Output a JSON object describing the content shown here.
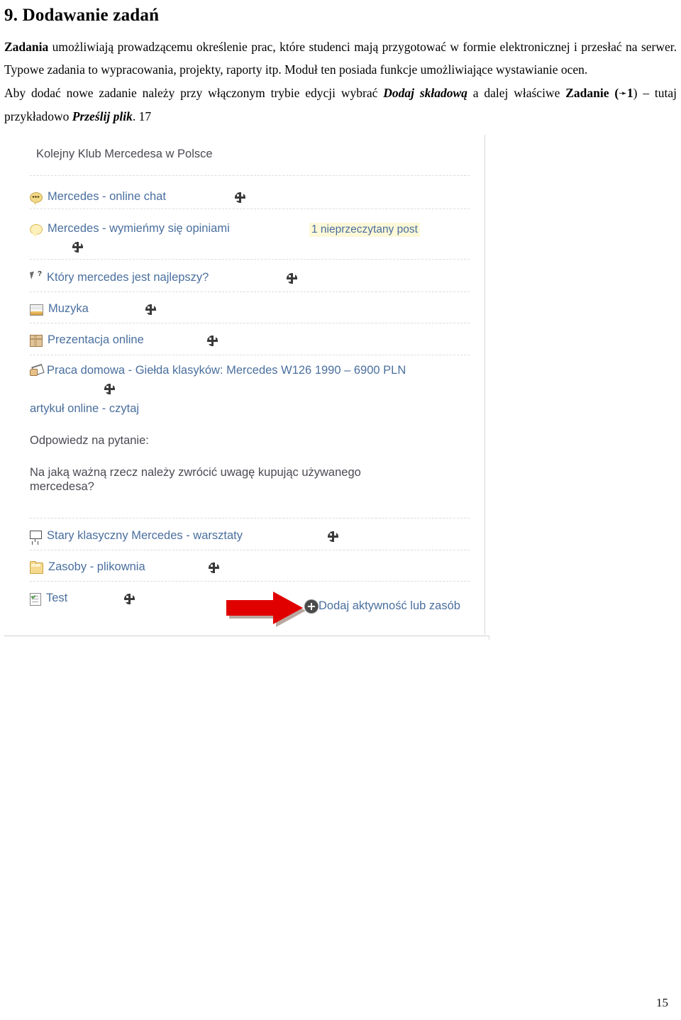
{
  "document": {
    "heading": "9. Dodawanie zadań",
    "paragraphs": [
      {
        "runs": [
          {
            "text": "Zadania",
            "style": "bold"
          },
          {
            "text": " umożliwiają prowadzącemu określenie prac, które studenci mają przygotować w formie elektronicznej i przesłać na serwer. Typowe zadania to wypracowania, projekty, raporty itp. Moduł ten posiada funkcje umożliwiające wystawianie ocen.",
            "style": "normal"
          }
        ]
      },
      {
        "runs": [
          {
            "text": "Aby dodać nowe zadanie należy przy włączonym trybie edycji wybrać ",
            "style": "normal"
          },
          {
            "text": "Dodaj składową",
            "style": "bold-italic"
          },
          {
            "text": " a dalej właściwe ",
            "style": "normal"
          },
          {
            "text": "Zadanie",
            "style": "bold"
          },
          {
            "text": " (",
            "style": "normal"
          },
          {
            "text": "➛",
            "style": "arrow"
          },
          {
            "text": "1",
            "style": "bold"
          },
          {
            "text": ") – tutaj przykładowo ",
            "style": "normal"
          },
          {
            "text": "Prześlij plik",
            "style": "bold-italic"
          },
          {
            "text": ". 17",
            "style": "normal"
          }
        ]
      }
    ],
    "page_number": "15"
  },
  "screenshot": {
    "section_title": "Kolejny Klub Mercedesa w Polsce",
    "activities": [
      {
        "icon": "chat-icon",
        "label": "Mercedes - online chat",
        "badge": null,
        "type": "link"
      },
      {
        "icon": "forum-icon",
        "label": "Mercedes - wymieńmy się opiniami",
        "badge": "1 nieprzeczytany post",
        "type": "link"
      },
      {
        "icon": "choice-icon",
        "label": "Który mercedes jest najlepszy?",
        "badge": null,
        "type": "link"
      },
      {
        "icon": "page-icon",
        "label": "Muzyka",
        "badge": null,
        "type": "link"
      },
      {
        "icon": "scorm-package-icon",
        "label": "Prezentacja online",
        "badge": null,
        "type": "link"
      },
      {
        "icon": "assignment-icon",
        "label": "Praca domowa - Giełda klasyków: Mercedes W126 1990 – 6900 PLN",
        "badge": null,
        "type": "link"
      },
      {
        "icon": null,
        "label": "artykuł online - czytaj",
        "badge": null,
        "type": "link"
      },
      {
        "icon": null,
        "label": "Odpowiedz na pytanie:",
        "badge": null,
        "type": "text"
      },
      {
        "icon": null,
        "label": "Na jaką ważną rzecz należy zwrócić uwagę kupując używanego mercedesa?",
        "badge": null,
        "type": "text"
      },
      {
        "icon": "workshop-icon",
        "label": "Stary klasyczny Mercedes - warsztaty",
        "badge": null,
        "type": "link"
      },
      {
        "icon": "folder-icon",
        "label": "Zasoby - plikownia",
        "badge": null,
        "type": "link"
      },
      {
        "icon": "quiz-icon",
        "label": "Test",
        "badge": null,
        "type": "link"
      }
    ],
    "add_activity_label": "Dodaj aktywność lub zasób",
    "annotation": {
      "shape": "red-arrow",
      "color": "#e00000",
      "points_to": "Dodaj aktywność lub zasób"
    },
    "colors": {
      "link": "#4a6f9e",
      "text": "#4a4a52",
      "badge_background": "#fcf8d8",
      "separator": "#dcdcdc"
    }
  }
}
